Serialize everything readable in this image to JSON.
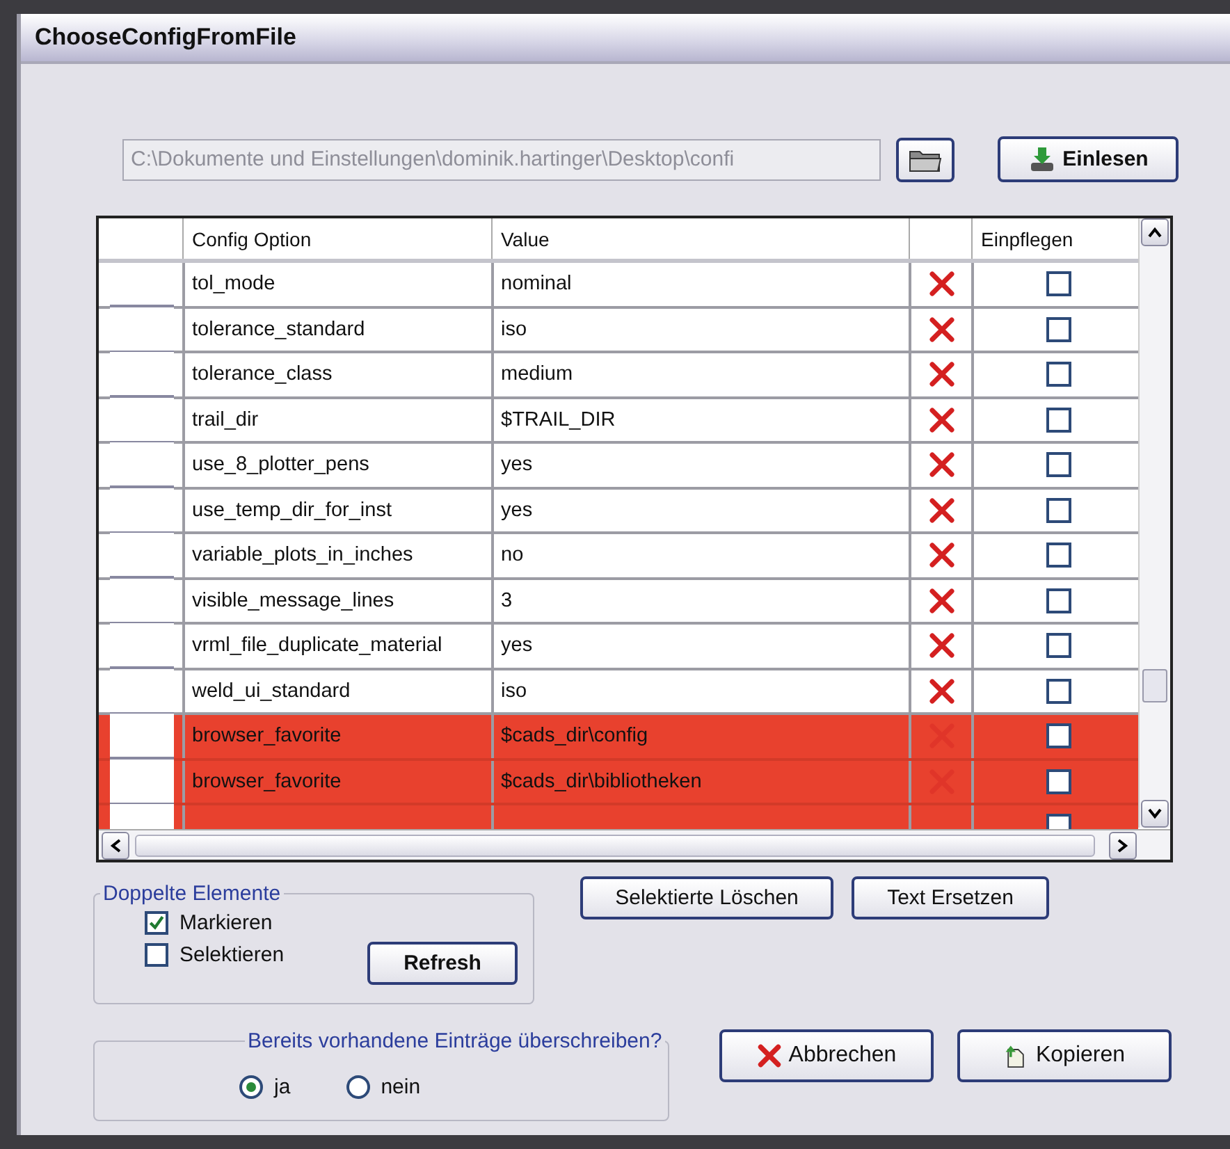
{
  "window": {
    "title": "ChooseConfigFromFile"
  },
  "path_field": {
    "value": "C:\\Dokumente und Einstellungen\\dominik.hartinger\\Desktop\\confi",
    "disabled": true
  },
  "load_button": {
    "label": "Einlesen"
  },
  "table": {
    "columns": [
      "Config Option",
      "Value",
      "",
      "Einpflegen"
    ],
    "rows": [
      {
        "kind": "row",
        "option": "tol_mode",
        "value": "nominal",
        "highlighted": false,
        "checked": false
      },
      {
        "kind": "row",
        "option": "tolerance_standard",
        "value": "iso",
        "highlighted": false,
        "checked": false
      },
      {
        "kind": "row",
        "option": "tolerance_class",
        "value": "medium",
        "highlighted": false,
        "checked": false
      },
      {
        "kind": "row",
        "option": "trail_dir",
        "value": "$TRAIL_DIR",
        "highlighted": false,
        "checked": false
      },
      {
        "kind": "row",
        "option": "use_8_plotter_pens",
        "value": "yes",
        "highlighted": false,
        "checked": false
      },
      {
        "kind": "row",
        "option": "use_temp_dir_for_inst",
        "value": "yes",
        "highlighted": false,
        "checked": false
      },
      {
        "kind": "row",
        "option": "variable_plots_in_inches",
        "value": "no",
        "highlighted": false,
        "checked": false
      },
      {
        "kind": "row",
        "option": "visible_message_lines",
        "value": "3",
        "highlighted": false,
        "checked": false
      },
      {
        "kind": "row",
        "option": "vrml_file_duplicate_material",
        "value": "yes",
        "highlighted": false,
        "checked": false
      },
      {
        "kind": "row",
        "option": "weld_ui_standard",
        "value": "iso",
        "highlighted": false,
        "checked": false
      },
      {
        "kind": "row",
        "option": "browser_favorite",
        "value": "$cads_dir\\config",
        "highlighted": true,
        "checked": false
      },
      {
        "kind": "row",
        "option": "browser_favorite",
        "value": "$cads_dir\\bibliotheken",
        "highlighted": true,
        "checked": false
      },
      {
        "kind": "partial",
        "highlighted": true
      }
    ]
  },
  "duplicates": {
    "title": "Doppelte Elemente",
    "options": [
      {
        "label": "Markieren",
        "checked": true
      },
      {
        "label": "Selektieren",
        "checked": false
      }
    ],
    "refresh_button": "Refresh"
  },
  "action_buttons": [
    "Selektierte Löschen",
    "Text Ersetzen"
  ],
  "overwrite": {
    "title": "Bereits vorhandene Einträge überschreiben?",
    "options": [
      {
        "label": "ja",
        "selected": true
      },
      {
        "label": "nein",
        "selected": false
      }
    ]
  },
  "buttons": [
    {
      "kind": "cancel",
      "label": "Abbrechen"
    },
    {
      "kind": "copy",
      "label": "Kopieren"
    }
  ]
}
